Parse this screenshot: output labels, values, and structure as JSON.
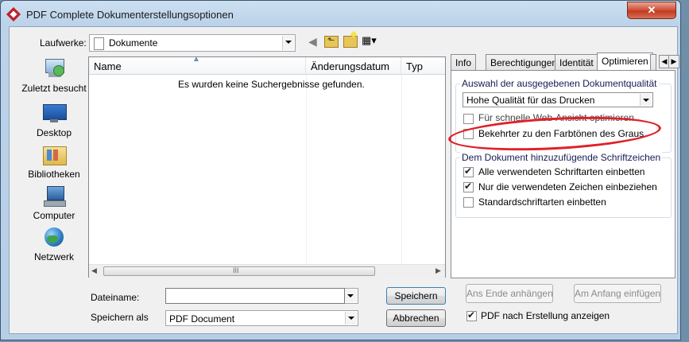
{
  "window": {
    "title": "PDF Complete Dokumenterstellungsoptionen",
    "close_glyph": "✕"
  },
  "toolbar": {
    "drives_label": "Laufwerke:",
    "location_value": "Dokumente",
    "back_glyph": "◀",
    "up_glyph": "⬑",
    "view_glyph": "▦▾"
  },
  "places": [
    {
      "label": "Zuletzt besucht",
      "icon": "recent-places-icon"
    },
    {
      "label": "Desktop",
      "icon": "desktop-icon"
    },
    {
      "label": "Bibliotheken",
      "icon": "libraries-icon"
    },
    {
      "label": "Computer",
      "icon": "computer-icon"
    },
    {
      "label": "Netzwerk",
      "icon": "network-icon"
    }
  ],
  "filelist": {
    "columns": [
      "Name",
      "Änderungsdatum",
      "Typ"
    ],
    "empty_message": "Es wurden keine Suchergebnisse gefunden.",
    "scroll_grip": "III"
  },
  "tabs": [
    "Info",
    "Berechtigungen",
    "Identität",
    "Optimieren"
  ],
  "active_tab": "Optimieren",
  "optimize": {
    "quality_group_title": "Auswahl der ausgegebenen Dokumentqualität",
    "quality_value": "Hohe Qualität für das Drucken",
    "web_view_label": "Für schnelle Web-Ansicht optimieren",
    "web_view_checked": false,
    "grayscale_label": "Bekehrter zu den Farbtönen des Graus",
    "grayscale_checked": false,
    "fonts_group_title": "Dem Dokument hinzuzufügende Schriftzeichen",
    "embed_all_label": "Alle verwendeten Schriftarten einbetten",
    "embed_all_checked": true,
    "subset_label": "Nur die verwendeten Zeichen einbeziehen",
    "subset_checked": true,
    "standard_fonts_label": "Standardschriftarten einbetten",
    "standard_fonts_checked": false
  },
  "form": {
    "filename_label": "Dateiname:",
    "filename_value": "",
    "save_as_label": "Speichern als",
    "save_as_value": "PDF Document"
  },
  "buttons": {
    "save": "Speichern",
    "cancel": "Abbrechen",
    "append_end": "Ans Ende anhängen",
    "insert_start": "Am Anfang einfügen"
  },
  "show_pdf": {
    "label": "PDF nach Erstellung anzeigen",
    "checked": true
  },
  "colors": {
    "annotation": "#e0202a",
    "window_frame": "#bcd3ea",
    "group_title": "#151c55"
  }
}
